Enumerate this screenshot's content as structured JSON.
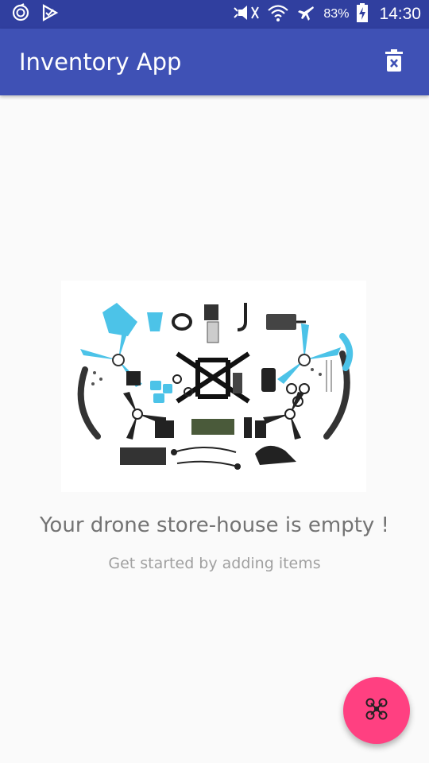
{
  "status_bar": {
    "battery": "83%",
    "time": "14:30",
    "icons": [
      "sync-icon",
      "check-icon",
      "mute-icon",
      "wifi-icon",
      "airplane-icon",
      "battery-charging-icon"
    ]
  },
  "toolbar": {
    "title": "Inventory App",
    "action_icon": "delete-all-icon"
  },
  "empty_view": {
    "image": "drone-parts-image",
    "title": "Your drone store-house is empty !",
    "subtitle": "Get started by adding items"
  },
  "fab": {
    "icon": "drone-icon"
  },
  "colors": {
    "primary": "#3f51b5",
    "primary_dark": "#303f9f",
    "accent": "#ff4081",
    "drone_blue": "#4cc3e8"
  }
}
